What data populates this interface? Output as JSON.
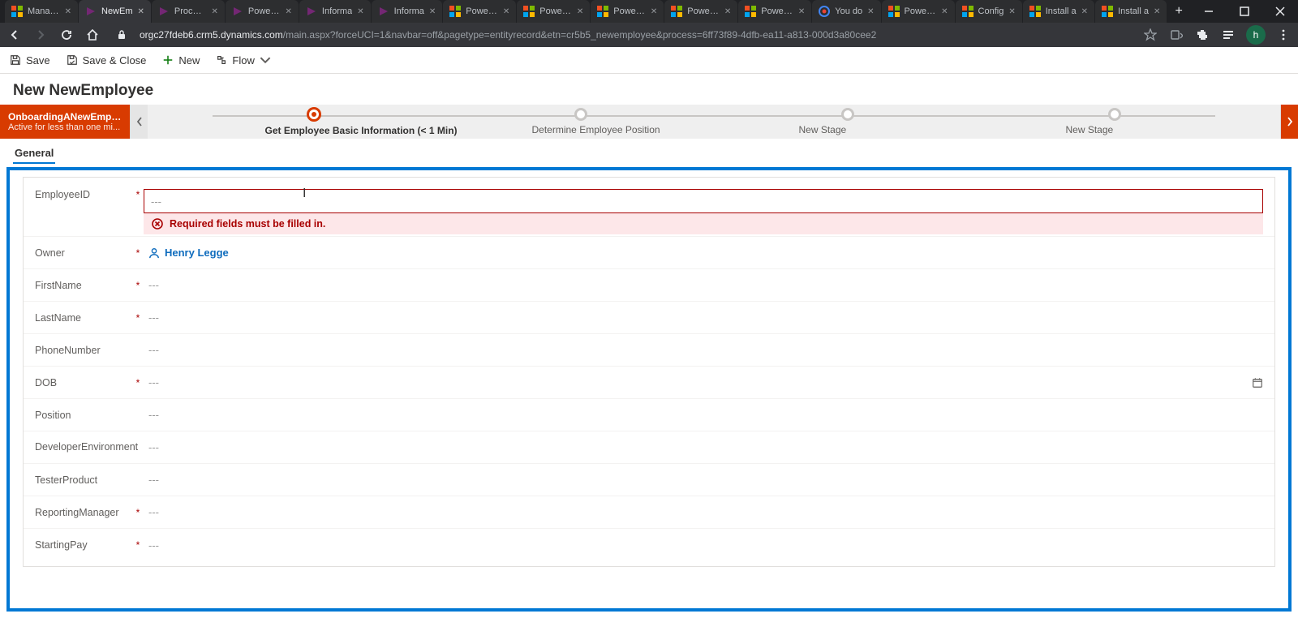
{
  "browser": {
    "tabs": [
      {
        "title": "Manage",
        "favtype": "ms"
      },
      {
        "title": "NewEm",
        "favtype": "pa",
        "active": true
      },
      {
        "title": "Process",
        "favtype": "pa"
      },
      {
        "title": "Power A",
        "favtype": "pa"
      },
      {
        "title": "Informa",
        "favtype": "pa"
      },
      {
        "title": "Informa",
        "favtype": "pa"
      },
      {
        "title": "Power F",
        "favtype": "ms"
      },
      {
        "title": "Power F",
        "favtype": "ms"
      },
      {
        "title": "Power F",
        "favtype": "ms"
      },
      {
        "title": "Power F",
        "favtype": "ms"
      },
      {
        "title": "Power F",
        "favtype": "ms"
      },
      {
        "title": "You do",
        "favtype": "g"
      },
      {
        "title": "Power F",
        "favtype": "ms"
      },
      {
        "title": "Config",
        "favtype": "ms"
      },
      {
        "title": "Install a",
        "favtype": "ms"
      },
      {
        "title": "Install a",
        "favtype": "ms"
      }
    ],
    "url_host": "orgc27fdeb6.crm5.dynamics.com",
    "url_path": "/main.aspx?forceUCI=1&navbar=off&pagetype=entityrecord&etn=cr5b5_newemployee&process=6ff73f89-4dfb-ea11-a813-000d3a80cee2",
    "profile_letter": "h"
  },
  "commands": {
    "save": "Save",
    "save_close": "Save & Close",
    "new": "New",
    "flow": "Flow"
  },
  "page_title": "New NewEmployee",
  "bpf": {
    "name": "OnboardingANewEmplo...",
    "status": "Active for less than one mi...",
    "stages": [
      {
        "label": "Get Employee Basic Information  (< 1 Min)",
        "active": true
      },
      {
        "label": "Determine Employee Position"
      },
      {
        "label": "New Stage"
      },
      {
        "label": "New Stage"
      }
    ]
  },
  "form_tab": "General",
  "error_message": "Required fields must be filled in.",
  "empty_value": "---",
  "owner_value": "Henry Legge",
  "fields": {
    "employeeid": {
      "label": "EmployeeID",
      "required": true
    },
    "owner": {
      "label": "Owner",
      "required": true
    },
    "firstname": {
      "label": "FirstName",
      "required": true
    },
    "lastname": {
      "label": "LastName",
      "required": true
    },
    "phone": {
      "label": "PhoneNumber",
      "required": false
    },
    "dob": {
      "label": "DOB",
      "required": true
    },
    "position": {
      "label": "Position",
      "required": false
    },
    "devenv": {
      "label": "DeveloperEnvironment",
      "required": false
    },
    "testerprod": {
      "label": "TesterProduct",
      "required": false
    },
    "manager": {
      "label": "ReportingManager",
      "required": true
    },
    "startingpay": {
      "label": "StartingPay",
      "required": true
    }
  }
}
